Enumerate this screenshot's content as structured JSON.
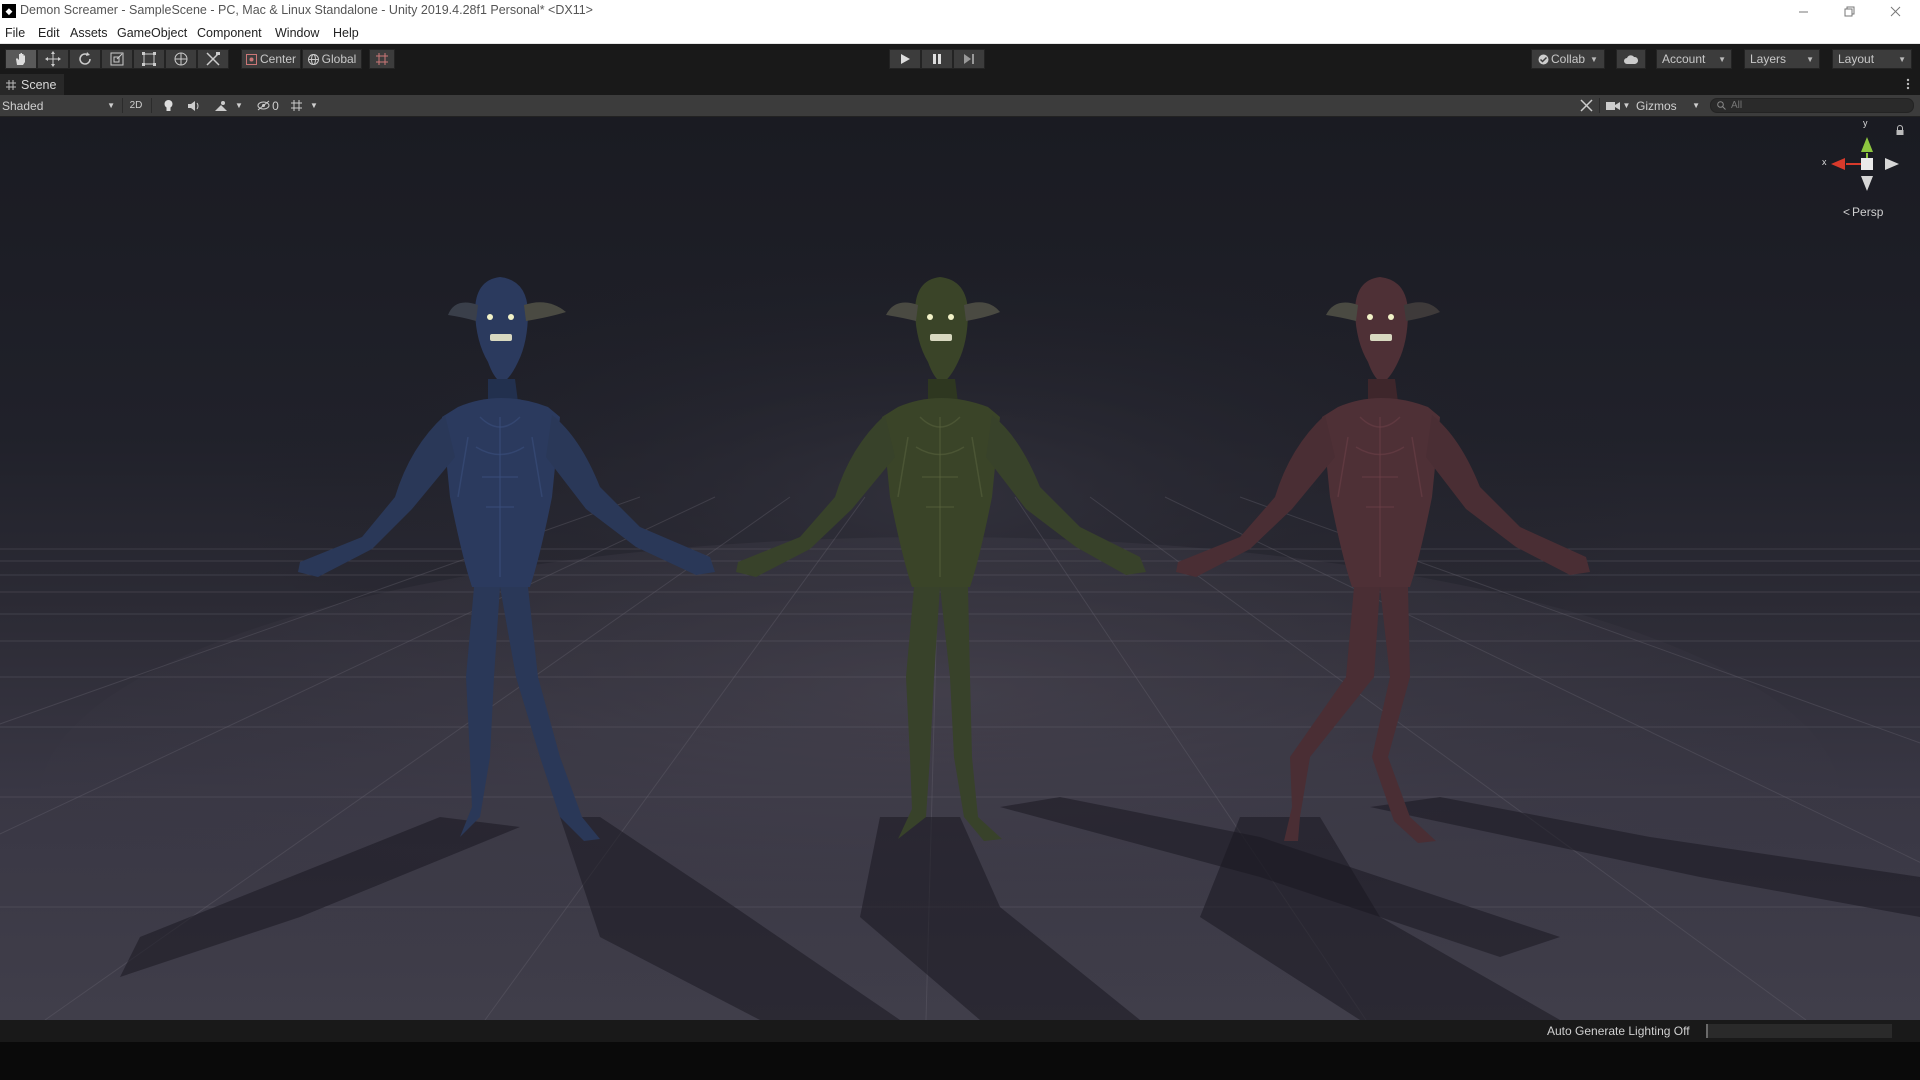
{
  "window": {
    "title": "Demon Screamer - SampleScene - PC, Mac & Linux Standalone - Unity 2019.4.28f1 Personal* <DX11>",
    "logo_text": "◆"
  },
  "menu": [
    "File",
    "Edit",
    "Assets",
    "GameObject",
    "Component",
    "Window",
    "Help"
  ],
  "toolbar": {
    "pivot_label": "Center",
    "space_label": "Global",
    "collab_label": "Collab",
    "account_label": "Account",
    "layers_label": "Layers",
    "layout_label": "Layout"
  },
  "scene": {
    "tab_label": "Scene",
    "draw_mode": "Shaded",
    "mode_2d": "2D",
    "hidden_count": "0",
    "gizmos_label": "Gizmos",
    "search_placeholder": "All",
    "gizmo": {
      "x_label": "x",
      "y_label": "y",
      "projection_label": "Persp"
    },
    "characters": [
      {
        "name": "demon-blue",
        "color": "#2b3a5e"
      },
      {
        "name": "demon-green",
        "color": "#3a4428"
      },
      {
        "name": "demon-red",
        "color": "#4e3036"
      }
    ]
  },
  "status": {
    "lighting_text": "Auto Generate Lighting Off"
  },
  "colors": {
    "toolbar_bg": "#191919",
    "button_bg": "#3c3c3c",
    "active_tool": "#595959",
    "gizmo_x": "#d83a2b",
    "gizmo_y": "#8dc63f"
  }
}
